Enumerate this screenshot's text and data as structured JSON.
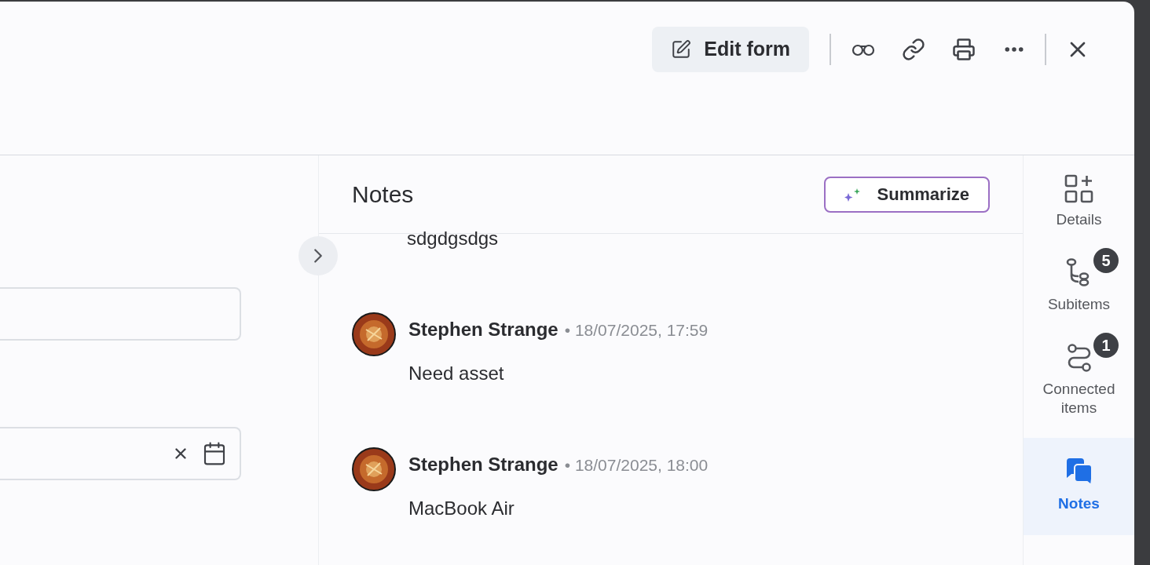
{
  "toolbar": {
    "edit_button": "Edit form"
  },
  "form_fields": [
    {
      "kind": "text"
    },
    {
      "kind": "date"
    }
  ],
  "notes": {
    "title": "Notes",
    "summarize_button": "Summarize",
    "entries": [
      {
        "text": "sdgdgsdgs"
      },
      {
        "author": "Stephen Strange",
        "time": "• 18/07/2025, 17:59",
        "text": "Need asset"
      },
      {
        "author": "Stephen Strange",
        "time": "• 18/07/2025, 18:00",
        "text": "MacBook Air"
      }
    ]
  },
  "sidebar": {
    "items": [
      {
        "kind": "details",
        "label": "Details",
        "selected": false
      },
      {
        "kind": "subitems",
        "label": "Subitems",
        "badge": "5",
        "selected": false
      },
      {
        "kind": "connected",
        "label": "Connected items",
        "badge": "1",
        "selected": false
      },
      {
        "kind": "notes",
        "label": "Notes",
        "selected": true
      }
    ]
  }
}
